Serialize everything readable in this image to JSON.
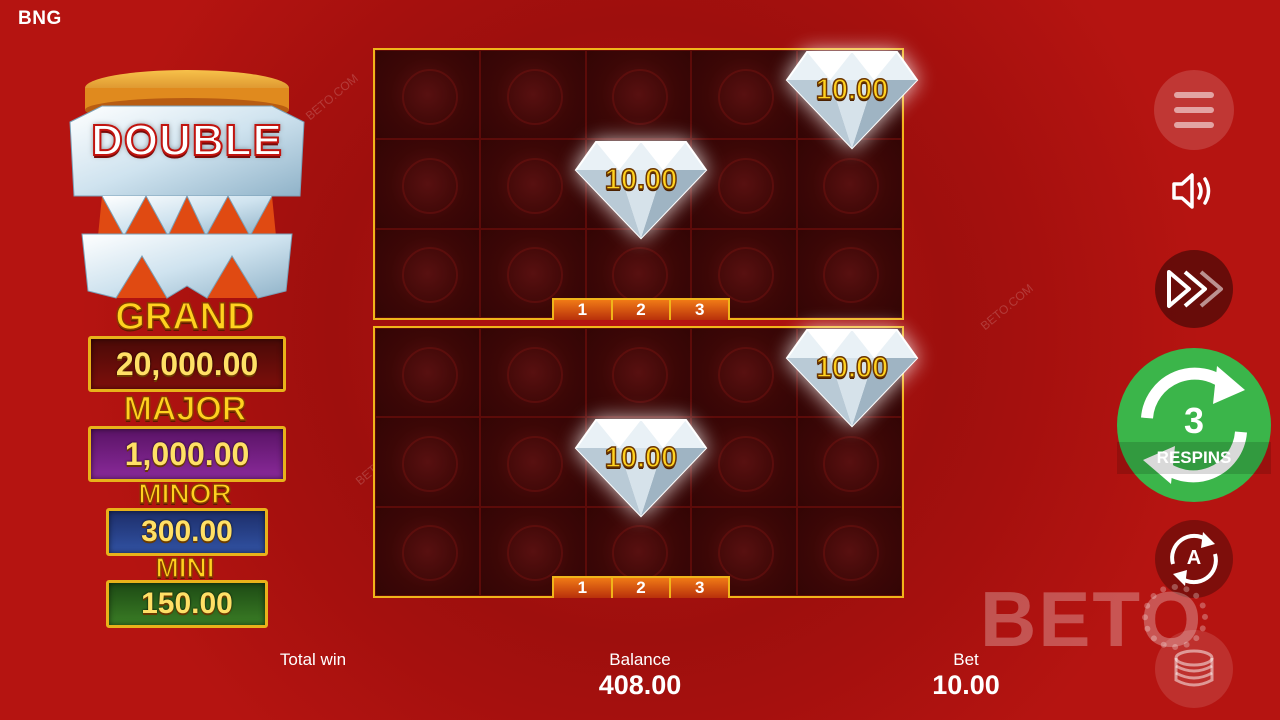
{
  "header": {
    "brand": "BNG"
  },
  "logo": {
    "word": "DOUBLE"
  },
  "jackpots": {
    "grand": {
      "label": "GRAND",
      "value": "20,000.00"
    },
    "major": {
      "label": "MAJOR",
      "value": "1,000.00"
    },
    "minor": {
      "label": "MINOR",
      "value": "300.00"
    },
    "mini": {
      "label": "MINI",
      "value": "150.00"
    }
  },
  "boards": [
    {
      "gems": [
        "10.00",
        "10.00"
      ],
      "row_indicators": [
        "1",
        "2",
        "3"
      ]
    },
    {
      "gems": [
        "10.00",
        "10.00"
      ],
      "row_indicators": [
        "1",
        "2",
        "3"
      ]
    }
  ],
  "controls": {
    "respins_count": "3",
    "respins_label": "RESPINS",
    "auto_letter": "A"
  },
  "bottom_bar": {
    "total_win_label": "Total win",
    "balance_label": "Balance",
    "balance_value": "408.00",
    "bet_label": "Bet",
    "bet_value": "10.00"
  },
  "watermark": {
    "text": "BETO",
    "small": "BETO.COM"
  },
  "colors": {
    "accent_gold": "#f0b51a",
    "background_red": "#a5100e",
    "spin_green": "#3bb54a"
  }
}
